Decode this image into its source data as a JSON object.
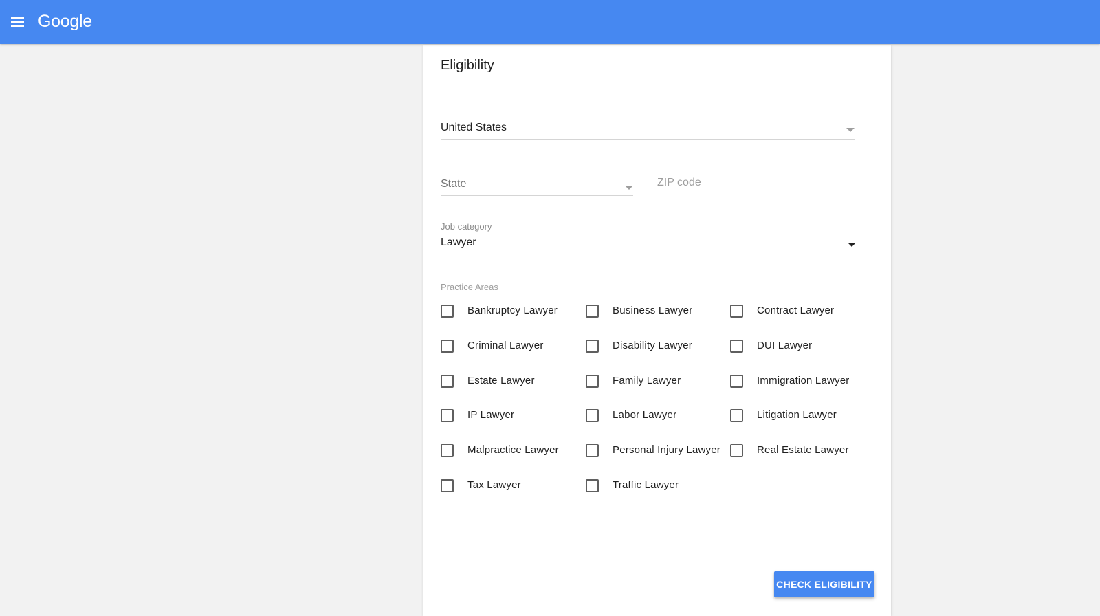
{
  "header": {
    "logo_text": "Google",
    "menu_icon": "hamburger-menu-icon",
    "background_color": "#4688f1"
  },
  "form": {
    "title": "Eligibility",
    "country": {
      "value": "United States"
    },
    "state": {
      "placeholder": "State"
    },
    "zip": {
      "placeholder": "ZIP code",
      "value": ""
    },
    "job_category": {
      "label": "Job category",
      "value": "Lawyer"
    },
    "practice_areas": {
      "label": "Practice Areas",
      "items": [
        {
          "label": "Bankruptcy Lawyer",
          "checked": false
        },
        {
          "label": "Business Lawyer",
          "checked": false
        },
        {
          "label": "Contract Lawyer",
          "checked": false
        },
        {
          "label": "Criminal Lawyer",
          "checked": false
        },
        {
          "label": "Disability Lawyer",
          "checked": false
        },
        {
          "label": "DUI Lawyer",
          "checked": false
        },
        {
          "label": "Estate Lawyer",
          "checked": false
        },
        {
          "label": "Family Lawyer",
          "checked": false
        },
        {
          "label": "Immigration Lawyer",
          "checked": false
        },
        {
          "label": "IP Lawyer",
          "checked": false
        },
        {
          "label": "Labor Lawyer",
          "checked": false
        },
        {
          "label": "Litigation Lawyer",
          "checked": false
        },
        {
          "label": "Malpractice Lawyer",
          "checked": false
        },
        {
          "label": "Personal Injury Lawyer",
          "checked": false
        },
        {
          "label": "Real Estate Lawyer",
          "checked": false
        },
        {
          "label": "Tax Lawyer",
          "checked": false
        },
        {
          "label": "Traffic Lawyer",
          "checked": false
        }
      ]
    },
    "submit_label": "CHECK ELIGIBILITY",
    "accent_color": "#4688f1"
  }
}
